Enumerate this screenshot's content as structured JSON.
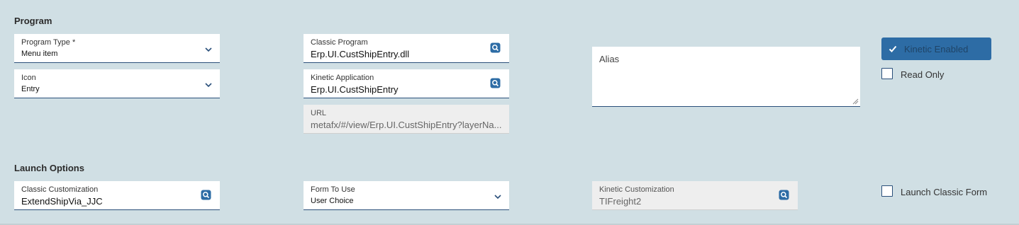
{
  "program": {
    "section_title": "Program",
    "program_type": {
      "label": "Program Type *",
      "value": "Menu item"
    },
    "icon": {
      "label": "Icon",
      "value": "Entry"
    },
    "classic_program": {
      "label": "Classic Program",
      "value": "Erp.UI.CustShipEntry.dll"
    },
    "kinetic_application": {
      "label": "Kinetic Application",
      "value": "Erp.UI.CustShipEntry"
    },
    "url": {
      "label": "URL",
      "value": "metafx/#/view/Erp.UI.CustShipEntry?layerNa..."
    },
    "alias": {
      "placeholder": "Alias"
    },
    "kinetic_enabled": {
      "label": "Kinetic Enabled",
      "checked": true
    },
    "read_only": {
      "label": "Read Only",
      "checked": false
    }
  },
  "launch_options": {
    "section_title": "Launch Options",
    "classic_customization": {
      "label": "Classic Customization",
      "value": "ExtendShipVia_JJC"
    },
    "form_to_use": {
      "label": "Form To Use",
      "value": "User Choice"
    },
    "kinetic_customization": {
      "label": "Kinetic Customization",
      "value": "TIFreight2"
    },
    "launch_classic_form": {
      "label": "Launch Classic Form",
      "checked": false
    }
  },
  "colors": {
    "background": "#d0dfe4",
    "accent": "#2d6ca5",
    "field_border": "#2a4f7a"
  }
}
